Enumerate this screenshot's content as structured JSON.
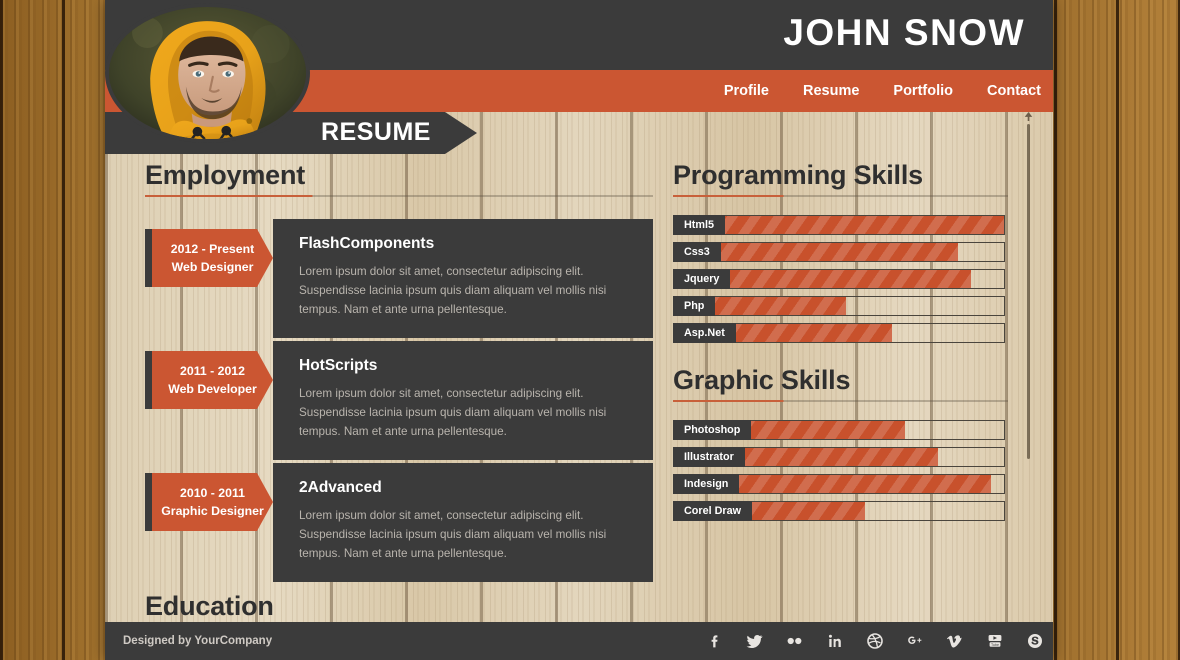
{
  "site": {
    "name": "JOHN SNOW",
    "page_badge": "RESUME"
  },
  "nav": {
    "items": [
      {
        "label": "Profile"
      },
      {
        "label": "Resume"
      },
      {
        "label": "Portfolio"
      },
      {
        "label": "Contact"
      }
    ]
  },
  "avatar": {
    "alt": "profile-photo-man-in-yellow-hooded-raincoat"
  },
  "employment": {
    "heading": "Employment",
    "jobs": [
      {
        "years": "2012 - Present",
        "role": "Web Designer",
        "company": "FlashComponents",
        "description": "Lorem ipsum dolor sit amet, consectetur adipiscing elit. Suspendisse lacinia ipsum quis diam aliquam vel mollis nisi tempus. Nam et ante urna pellentesque."
      },
      {
        "years": "2011 - 2012",
        "role": "Web Developer",
        "company": "HotScripts",
        "description": "Lorem ipsum dolor sit amet, consectetur adipiscing elit. Suspendisse lacinia ipsum quis diam aliquam vel mollis nisi tempus. Nam et ante urna pellentesque."
      },
      {
        "years": "2010 - 2011",
        "role": "Graphic Designer",
        "company": "2Advanced",
        "description": "Lorem ipsum dolor sit amet, consectetur adipiscing elit. Suspendisse lacinia ipsum quis diam aliquam vel mollis nisi tempus. Nam et ante urna pellentesque."
      }
    ]
  },
  "education": {
    "heading": "Education"
  },
  "programming_skills": {
    "heading": "Programming Skills",
    "items": [
      {
        "label": "Html5",
        "percent": 100
      },
      {
        "label": "Css3",
        "percent": 86
      },
      {
        "label": "Jquery",
        "percent": 90
      },
      {
        "label": "Php",
        "percent": 52
      },
      {
        "label": "Asp.Net",
        "percent": 66
      }
    ]
  },
  "graphic_skills": {
    "heading": "Graphic Skills",
    "items": [
      {
        "label": "Photoshop",
        "percent": 70
      },
      {
        "label": "Illustrator",
        "percent": 80
      },
      {
        "label": "Indesign",
        "percent": 96
      },
      {
        "label": "Corel Draw",
        "percent": 58
      }
    ]
  },
  "footer": {
    "credit": "Designed by YourCompany",
    "social": [
      {
        "name": "facebook-icon"
      },
      {
        "name": "twitter-icon"
      },
      {
        "name": "flickr-icon"
      },
      {
        "name": "linkedin-icon"
      },
      {
        "name": "dribbble-icon"
      },
      {
        "name": "googleplus-icon"
      },
      {
        "name": "vimeo-icon"
      },
      {
        "name": "youtube-icon"
      },
      {
        "name": "skype-icon"
      }
    ]
  },
  "colors": {
    "accent": "#cb5632",
    "dark": "#3b3b3b",
    "bar_fill": "#c8512c",
    "wood_light": "#ded0b4",
    "wood_dark": "#a9762f"
  }
}
